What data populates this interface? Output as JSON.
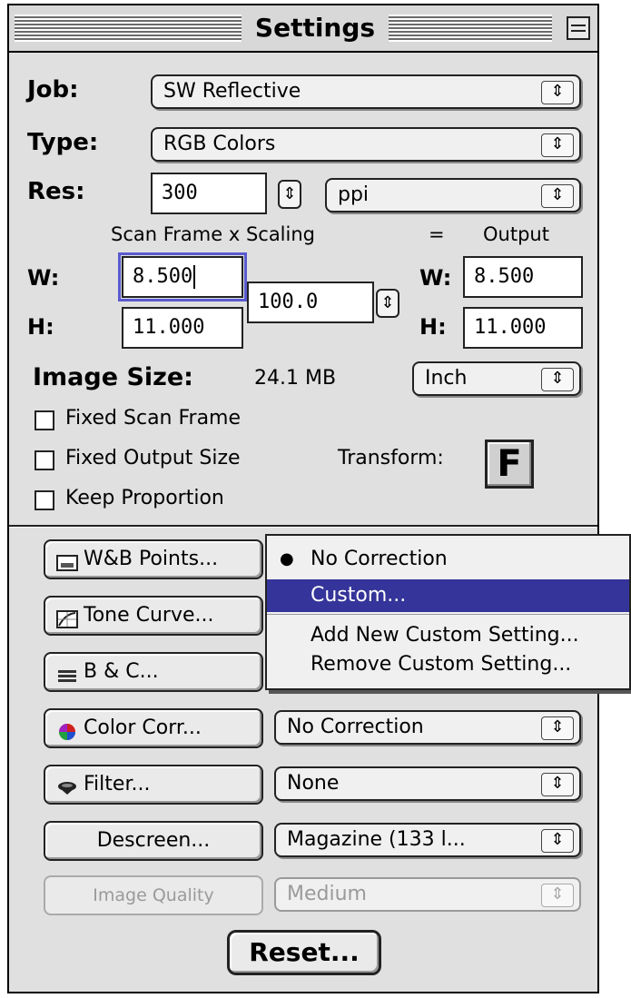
{
  "window": {
    "title": "Settings"
  },
  "job": {
    "label": "Job:",
    "value": "SW Reflective"
  },
  "type": {
    "label": "Type:",
    "value": "RGB Colors"
  },
  "res": {
    "label": "Res:",
    "value": "300",
    "unit": "ppi"
  },
  "scaling_header": {
    "left": "Scan Frame x Scaling",
    "equals": "=",
    "right": "Output"
  },
  "scan_frame": {
    "w_label": "W:",
    "w_value": "8.500",
    "h_label": "H:",
    "h_value": "11.000"
  },
  "scaling": {
    "value": "100.0"
  },
  "output": {
    "w_label": "W:",
    "w_value": "8.500",
    "h_label": "H:",
    "h_value": "11.000"
  },
  "image_size": {
    "label": "Image Size:",
    "value": "24.1 MB",
    "unit": "Inch"
  },
  "checkboxes": {
    "fixed_scan_frame": "Fixed Scan Frame",
    "fixed_output_size": "Fixed Output Size",
    "keep_proportion": "Keep Proportion"
  },
  "transform": {
    "label": "Transform:",
    "button": "F"
  },
  "buttons": {
    "wb_points": "W&B Points...",
    "tone_curve": "Tone Curve...",
    "bc": "B & C...",
    "color_corr": "Color Corr...",
    "filter": "Filter...",
    "descreen": "Descreen...",
    "image_quality": "Image Quality",
    "reset": "Reset..."
  },
  "popups": {
    "color_corr": "No Correction",
    "filter": "None",
    "descreen": "Magazine (133 l...",
    "image_quality": "Medium"
  },
  "menu": {
    "items": [
      {
        "label": "No Correction",
        "checked": true
      },
      {
        "label": "Custom...",
        "highlighted": true
      },
      {
        "label": "Add New Custom Setting..."
      },
      {
        "label": "Remove Custom Setting..."
      }
    ],
    "highlight_color": "#34349a"
  }
}
